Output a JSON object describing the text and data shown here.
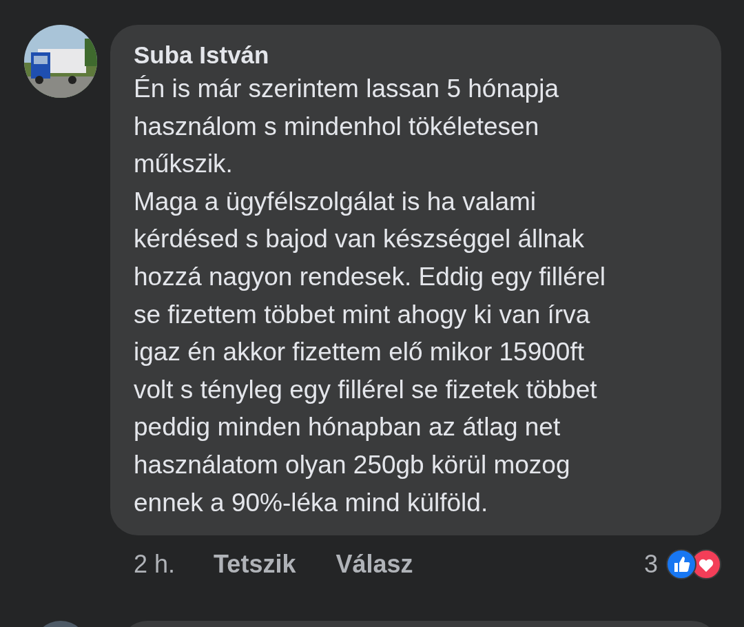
{
  "comment": {
    "author": "Suba István",
    "lines": [
      "Én is már szerintem lassan 5 hónapja",
      "használom s mindenhol tökéletesen",
      "műkszik.",
      "Maga a ügyfélszolgálat is ha valami",
      "kérdésed s bajod van készséggel állnak",
      "hozzá nagyon rendesek. Eddig egy fillérel",
      "se fizettem többet mint ahogy ki van írva",
      "igaz én akkor fizettem elő mikor 15900ft",
      "volt s tényleg egy fillérel se fizetek többet",
      "peddig minden hónapban az átlag net",
      "használatom olyan 250gb körül mozog",
      "ennek a 90%-léka mind külföld."
    ],
    "time": "2 h.",
    "actions": [
      "Tetszik",
      "Válasz"
    ],
    "reaction_count": "3",
    "reactions": [
      {
        "kind": "like"
      },
      {
        "kind": "love"
      }
    ]
  }
}
